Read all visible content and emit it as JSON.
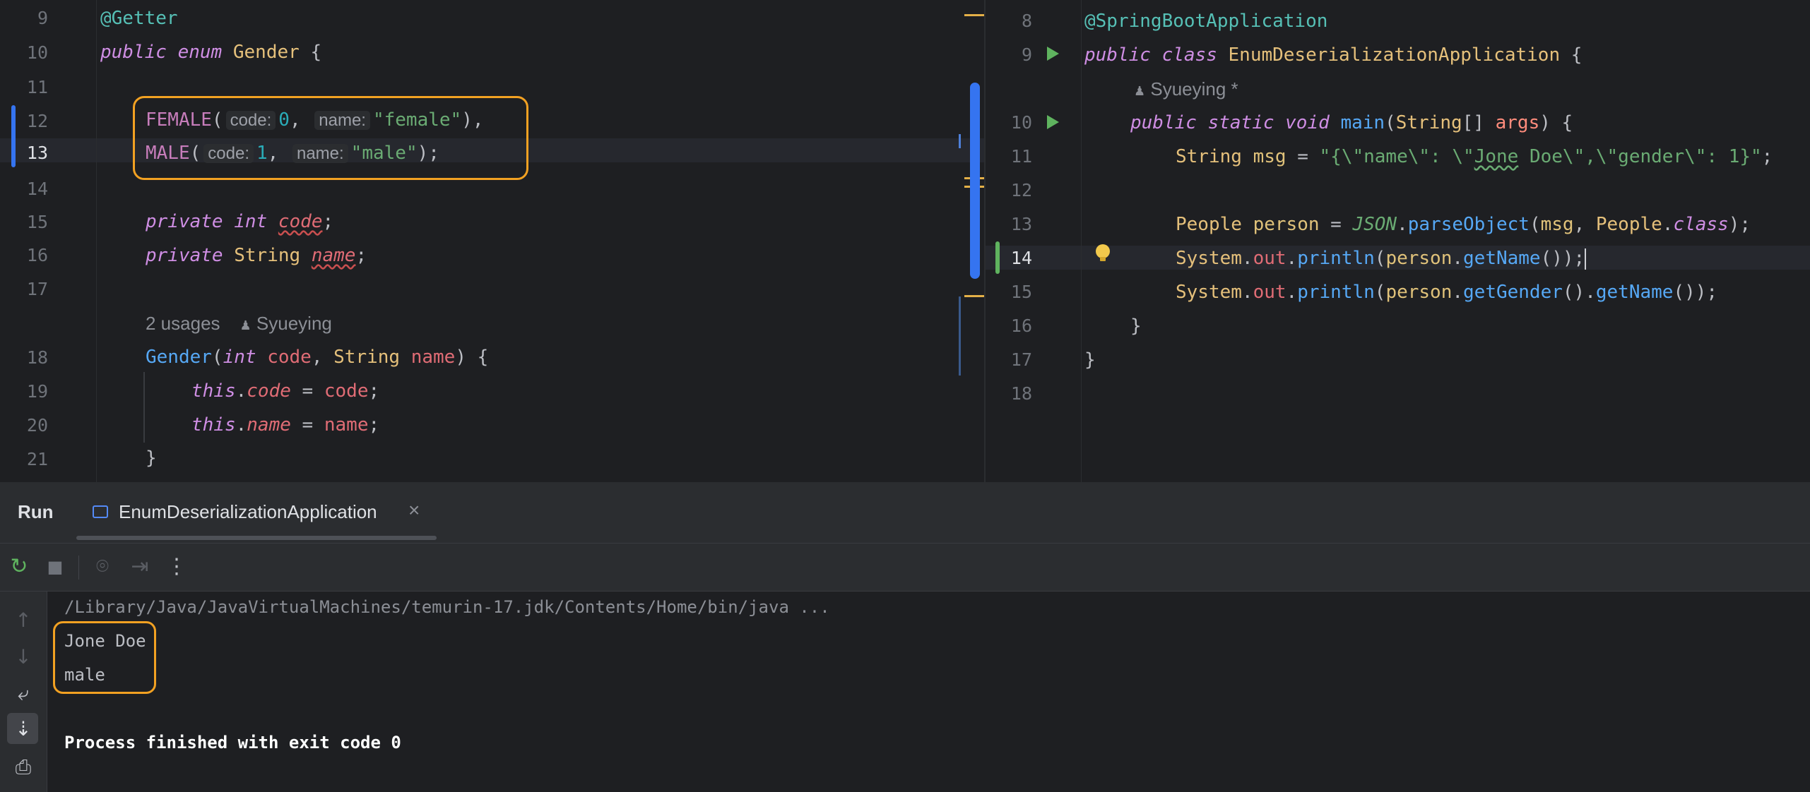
{
  "left_editor": {
    "lines": [
      {
        "n": "9"
      },
      {
        "n": "10"
      },
      {
        "n": "11"
      },
      {
        "n": "12"
      },
      {
        "n": "13"
      },
      {
        "n": "14"
      },
      {
        "n": "15"
      },
      {
        "n": "16"
      },
      {
        "n": "17"
      },
      {
        "n": ""
      },
      {
        "n": "18"
      },
      {
        "n": "19"
      },
      {
        "n": "20"
      },
      {
        "n": "21"
      }
    ],
    "code": {
      "l9_annotation": "@Getter",
      "l10_public": "public",
      "l10_enum": "enum",
      "l10_name": "Gender",
      "l10_brace": "{",
      "l12_const": "FEMALE",
      "l12_paren_open": "(",
      "l12_hint_code": "code:",
      "l12_code_val": "0",
      "l12_comma1": ",",
      "l12_hint_name": "name:",
      "l12_name_val": "\"female\"",
      "l12_tail": "),",
      "l13_const": "MALE",
      "l13_paren_open": "(",
      "l13_hint_code": "code:",
      "l13_code_val": "1",
      "l13_comma1": ",",
      "l13_hint_name": "name:",
      "l13_name_val": "\"male\"",
      "l13_tail": ");",
      "l15_private": "private",
      "l15_type": "int",
      "l15_field": "code",
      "l15_semi": ";",
      "l16_private": "private",
      "l16_type": "String",
      "l16_field": "name",
      "l16_semi": ";",
      "usages": "2 usages",
      "author": "Syueying",
      "l18_ctor": "Gender",
      "l18_open": "(",
      "l18_int": "int",
      "l18_p1": "code",
      "l18_comma": ",",
      "l18_string": "String",
      "l18_p2": "name",
      "l18_close": ") {",
      "l19_this": "this",
      "l19_dot": ".",
      "l19_field": "code",
      "l19_eq": " = ",
      "l19_val": "code",
      "l19_semi": ";",
      "l20_this": "this",
      "l20_dot": ".",
      "l20_field": "name",
      "l20_eq": " = ",
      "l20_val": "name",
      "l20_semi": ";",
      "l21_brace": "}"
    }
  },
  "right_editor": {
    "lines": [
      {
        "n": "8"
      },
      {
        "n": "9"
      },
      {
        "n": ""
      },
      {
        "n": "10"
      },
      {
        "n": "11"
      },
      {
        "n": "12"
      },
      {
        "n": "13"
      },
      {
        "n": "14"
      },
      {
        "n": "15"
      },
      {
        "n": "16"
      },
      {
        "n": "17"
      },
      {
        "n": "18"
      }
    ],
    "code": {
      "l8_annotation": "@SpringBootApplication",
      "l9_public": "public",
      "l9_class": "class",
      "l9_name": "EnumDeserializationApplication",
      "l9_brace": "{",
      "author": "Syueying *",
      "l10_public": "public",
      "l10_static": "static",
      "l10_void": "void",
      "l10_main": "main",
      "l10_open": "(",
      "l10_type": "String",
      "l10_arr": "[] ",
      "l10_args": "args",
      "l10_close": ") {",
      "l11_type": "String",
      "l11_var": "msg",
      "l11_eq": " = ",
      "l11_str1": "\"{\\\"name\\\": \\\"",
      "l11_jone": "Jone",
      "l11_str2": " Doe\\\",\\\"gender\\\": 1}\"",
      "l11_semi": ";",
      "l13_type": "People",
      "l13_var": "person",
      "l13_eq": " = ",
      "l13_json": "JSON",
      "l13_dot": ".",
      "l13_parse": "parseObject",
      "l13_open": "(",
      "l13_msg": "msg",
      "l13_comma": ", ",
      "l13_people": "People",
      "l13_dot2": ".",
      "l13_class": "class",
      "l13_close": ");",
      "l14_system": "System",
      "l14_dot1": ".",
      "l14_out": "out",
      "l14_dot2": ".",
      "l14_println": "println",
      "l14_open": "(",
      "l14_person": "person",
      "l14_dot3": ".",
      "l14_getname": "getName",
      "l14_close": "());",
      "l15_system": "System",
      "l15_dot1": ".",
      "l15_out": "out",
      "l15_dot2": ".",
      "l15_println": "println",
      "l15_open": "(",
      "l15_person": "person",
      "l15_dot3": ".",
      "l15_getgender": "getGender",
      "l15_mid": "().",
      "l15_getname": "getName",
      "l15_close": "());",
      "l16_brace": "}",
      "l17_brace": "}"
    }
  },
  "run_window": {
    "title": "Run",
    "tab_label": "EnumDeserializationApplication",
    "close_glyph": "×",
    "console": {
      "command": "/Library/Java/JavaVirtualMachines/temurin-17.jdk/Contents/Home/bin/java ...",
      "output": [
        "Jone Doe",
        "male"
      ],
      "exit_message": "Process finished with exit code 0"
    },
    "icons": {
      "rerun": "↻",
      "stop": "■",
      "camera": "⌾",
      "exit": "⇥",
      "more": "⋮",
      "up": "↑",
      "down": "↓",
      "wrap": "⤶",
      "scroll_end": "⇣",
      "print": "⎙"
    }
  }
}
